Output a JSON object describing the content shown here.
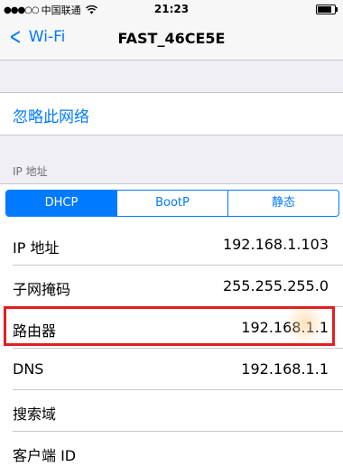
{
  "status_bar": {
    "carrier": "中国联通",
    "time": "21:23",
    "signal_dots": "●●●○○"
  },
  "nav": {
    "back_label": "Wi-Fi",
    "title": "FAST_46CE5E"
  },
  "forget_network": "忽略此网络",
  "ip_section": {
    "header": "IP 地址",
    "segments": [
      "DHCP",
      "BootP",
      "静态"
    ],
    "selected": "DHCP"
  },
  "rows": [
    {
      "label": "IP 地址",
      "value": "192.168.1.103"
    },
    {
      "label": "子网掩码",
      "value": "255.255.255.0"
    },
    {
      "label": "路由器",
      "value": "192.168.1.1"
    },
    {
      "label": "DNS",
      "value": "192.168.1.1"
    },
    {
      "label": "搜索域",
      "value": ""
    },
    {
      "label": "客户端 ID",
      "value": ""
    }
  ],
  "colors": {
    "accent": "#007aff",
    "highlight": "#e02020",
    "background": "#efeff4"
  }
}
